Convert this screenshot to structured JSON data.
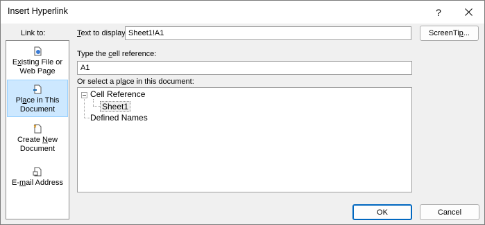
{
  "window": {
    "title": "Insert Hyperlink",
    "help_label": "?"
  },
  "link_to": {
    "label": "Link to:",
    "items": [
      {
        "pre": "E",
        "u": "x",
        "post": "isting File or",
        "line2": "Web Page",
        "icon": "file-globe-icon",
        "selected": false
      },
      {
        "pre": "Pl",
        "u": "a",
        "post": "ce in This",
        "line2": "Document",
        "icon": "document-place-icon",
        "selected": true
      },
      {
        "pre": "Create ",
        "u": "N",
        "post": "ew",
        "line2": "Document",
        "icon": "new-document-icon",
        "selected": false
      },
      {
        "pre": "E-",
        "u": "m",
        "post": "ail Address",
        "line2": "",
        "icon": "email-icon",
        "selected": false
      }
    ]
  },
  "text_to_display": {
    "pre": "",
    "u": "T",
    "post": "ext to display:",
    "value": "Sheet1!A1"
  },
  "screentip_button": {
    "pre": "ScreenTi",
    "u": "p",
    "post": "..."
  },
  "cell_reference": {
    "pre": "Type the ",
    "u": "c",
    "post": "ell reference:",
    "value": "A1"
  },
  "place_select": {
    "pre": "Or select a pl",
    "u": "a",
    "post": "ce in this document:"
  },
  "tree": {
    "root": "Cell Reference",
    "child": "Sheet1",
    "sibling": "Defined Names"
  },
  "buttons": {
    "ok": "OK",
    "cancel": "Cancel"
  }
}
